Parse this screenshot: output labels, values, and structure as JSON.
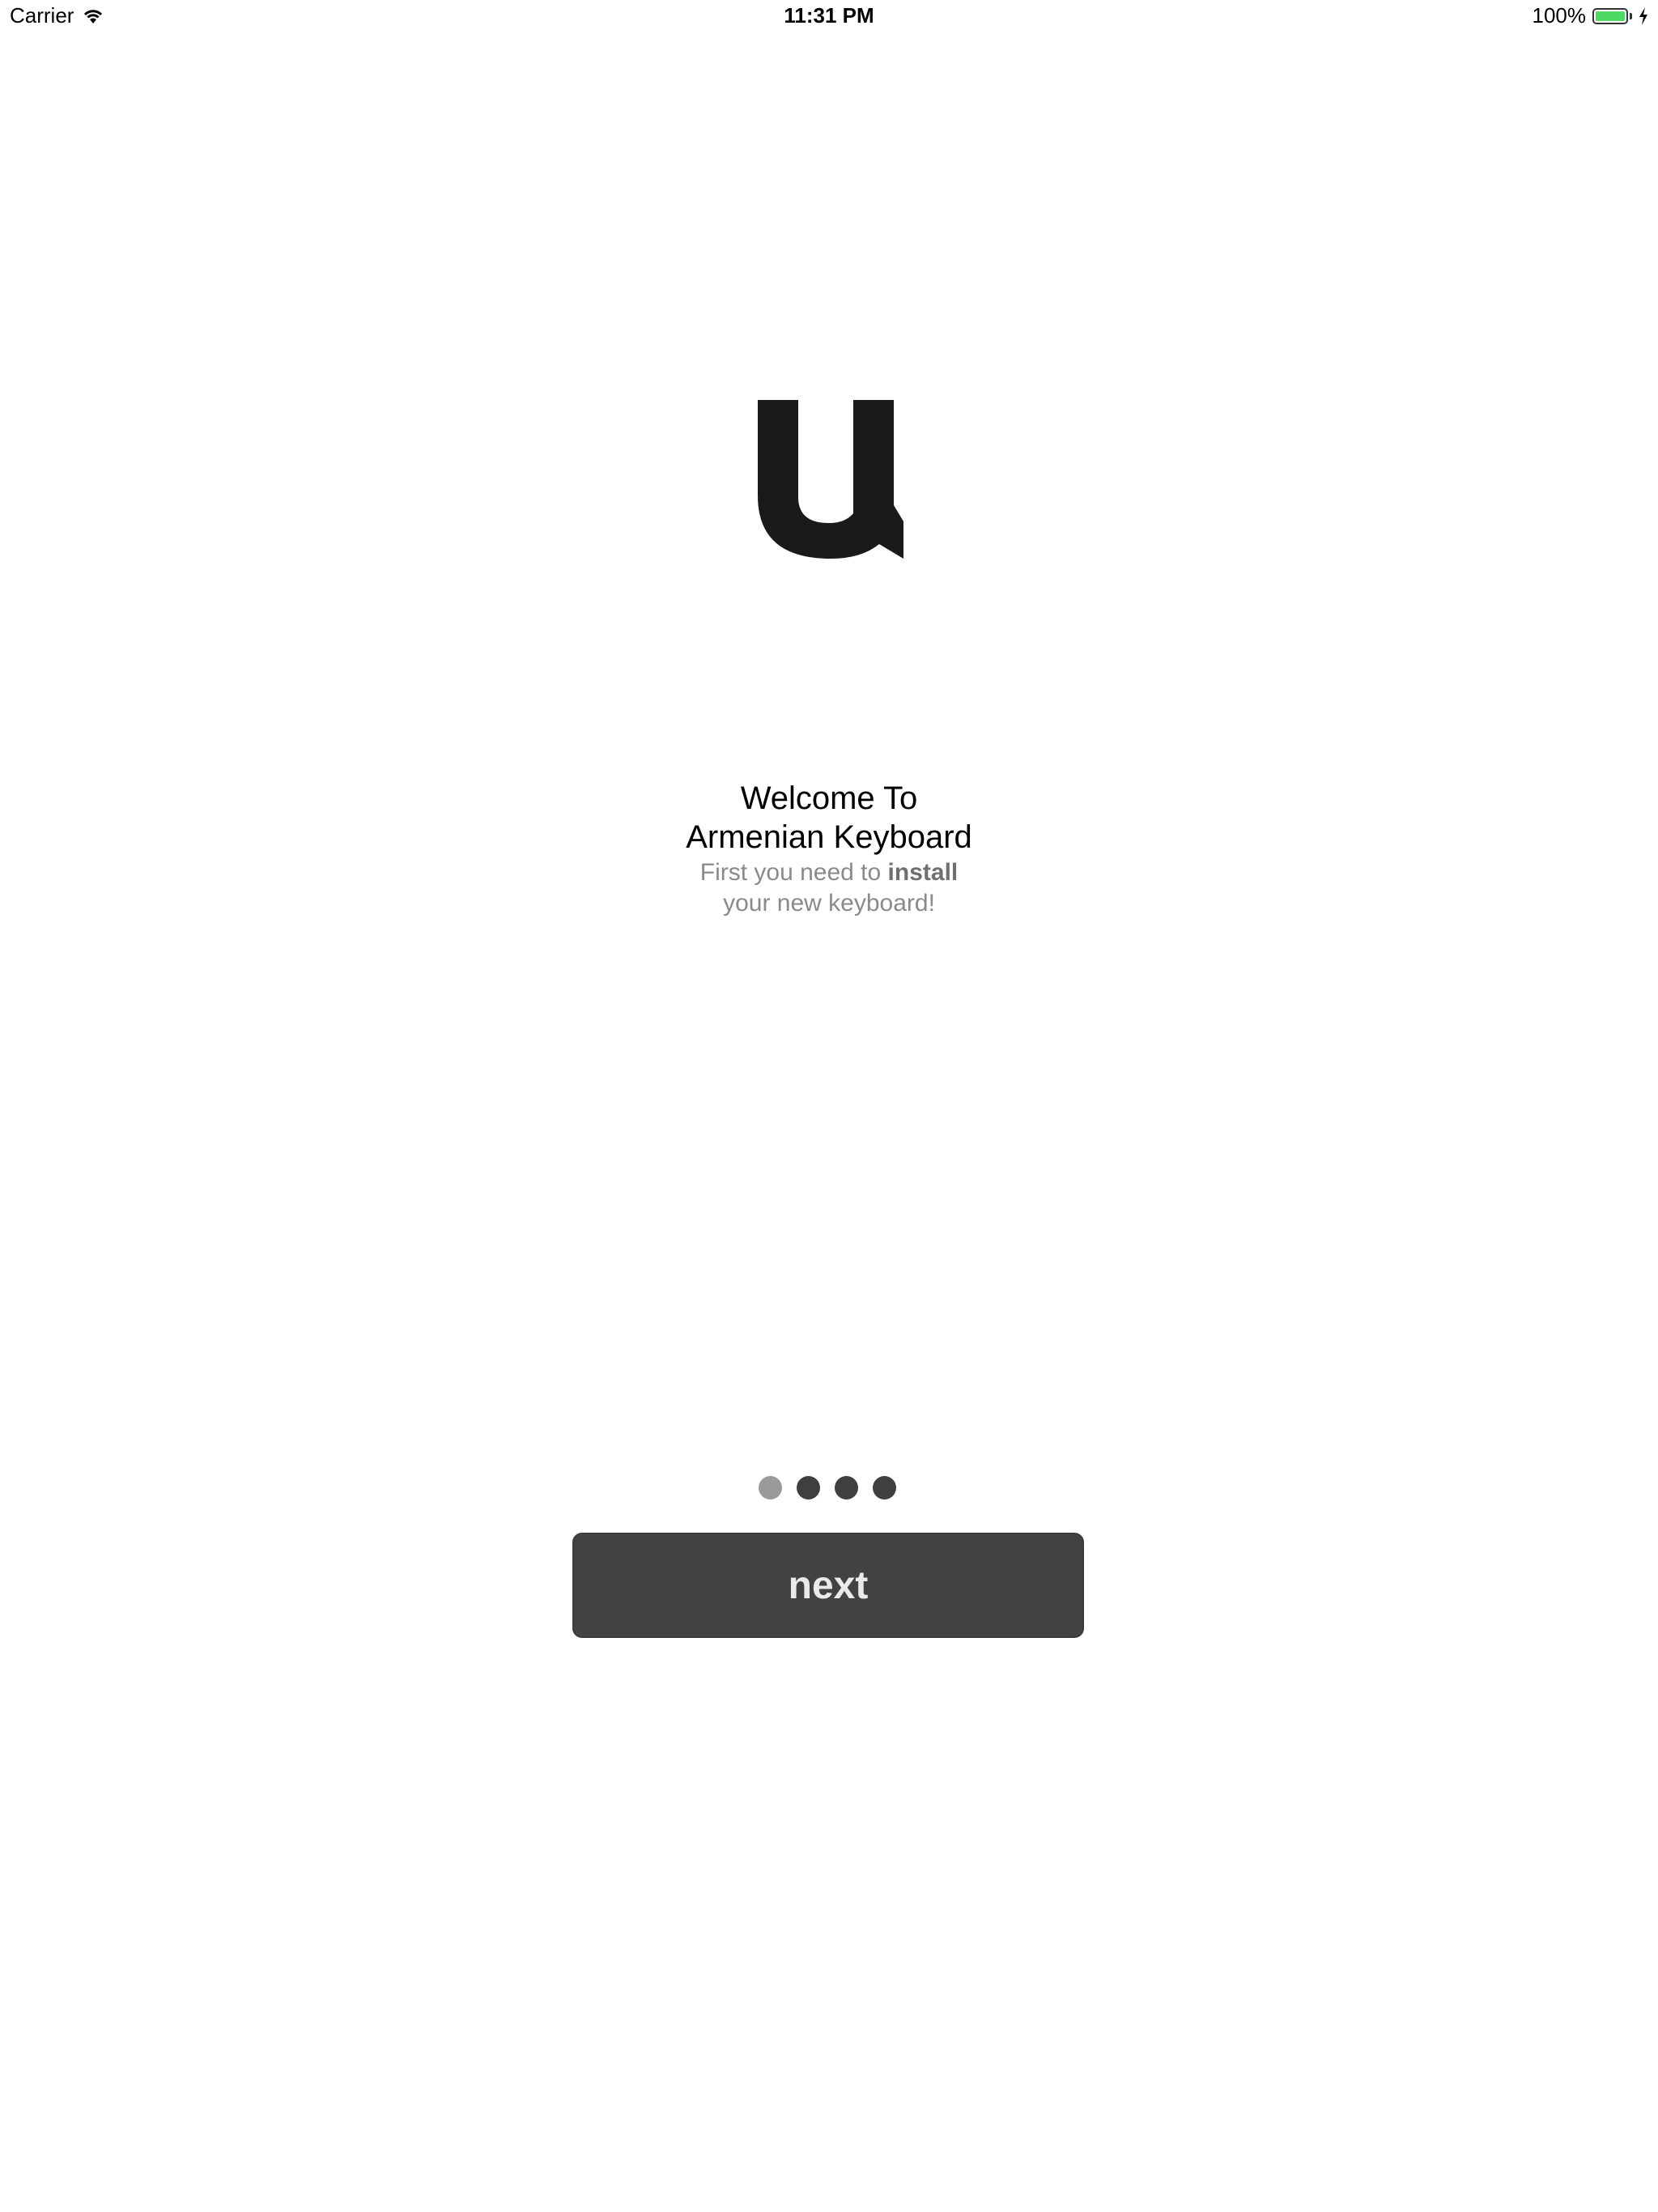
{
  "status_bar": {
    "carrier": "Carrier",
    "time": "11:31 PM",
    "battery_percent": "100%",
    "battery_level": 1.0,
    "icons": [
      "wifi-icon",
      "battery-icon",
      "charging-bolt-icon"
    ]
  },
  "logo": {
    "icon": "armenian-letter-logo-icon",
    "color": "#1a1a1a"
  },
  "welcome": {
    "title_line1": "Welcome To",
    "title_line2": "Armenian Keyboard",
    "subtitle_prefix": "First you need to ",
    "subtitle_bold": "install",
    "subtitle_line2": "your new keyboard!"
  },
  "pager": {
    "total": 4,
    "current": 1,
    "active_color": "#9a9a9a",
    "inactive_color": "#3f3f3f"
  },
  "next_button": {
    "label": "next",
    "background": "#424242"
  }
}
